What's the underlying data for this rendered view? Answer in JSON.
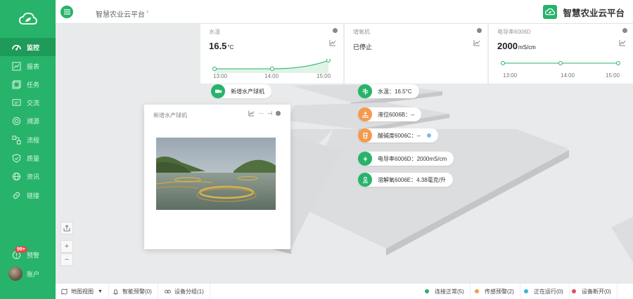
{
  "brand": {
    "title": "智慧农业云平台"
  },
  "breadcrumb": {
    "current": "智慧农业云平台",
    "arrow": "›"
  },
  "sidebar": {
    "items": [
      {
        "label": "监控",
        "icon": "dashboard-icon"
      },
      {
        "label": "报表",
        "icon": "chart-icon"
      },
      {
        "label": "任务",
        "icon": "task-icon"
      },
      {
        "label": "交流",
        "icon": "message-icon"
      },
      {
        "label": "溯源",
        "icon": "trace-icon"
      },
      {
        "label": "流程",
        "icon": "flow-icon"
      },
      {
        "label": "质量",
        "icon": "shield-icon"
      },
      {
        "label": "资讯",
        "icon": "globe-icon"
      },
      {
        "label": "链接",
        "icon": "link-icon"
      }
    ],
    "alarm": {
      "label": "预警",
      "badge": "99+"
    },
    "account": {
      "label": "账户"
    }
  },
  "stats": [
    {
      "label": "水温",
      "value": "16.5",
      "unit": "°C",
      "ticks": [
        "13:00",
        "14:00",
        "15:00"
      ]
    },
    {
      "label": "增氧机",
      "value": "已停止",
      "unit": "",
      "ticks": []
    },
    {
      "label": "电导率6006D",
      "value": "2000",
      "unit": "mS/cm",
      "ticks": [
        "13:00",
        "14:00",
        "15:00"
      ]
    }
  ],
  "callouts": [
    {
      "label": "新增水产球机",
      "icon": "camera-icon"
    },
    {
      "label": "水温：16.5°C",
      "icon": "thermometer-icon"
    },
    {
      "label": "液位6006B：--",
      "icon": "water-level-icon"
    },
    {
      "label": "酸碱度6006C：--",
      "icon": "ph-icon"
    },
    {
      "label": "电导率6006D：2000mS/cm",
      "icon": "lightning-icon"
    },
    {
      "label": "溶解氧6006E：4.38毫克/升",
      "icon": "oxygen-icon"
    }
  ],
  "popup": {
    "title": "新增水产球机",
    "more": "···",
    "pin": "⊣"
  },
  "map_controls": {
    "zoom_in": "+",
    "zoom_out": "−"
  },
  "footer": {
    "map_view": "地图视图",
    "smart_alarm": "智能预警(0)",
    "device_group": "设备分组(1)",
    "status": [
      {
        "label": "连接正常(5)",
        "color": "#27b36a"
      },
      {
        "label": "传感预警(2)",
        "color": "#f49a4e"
      },
      {
        "label": "正在运行(0)",
        "color": "#3ab5e6"
      },
      {
        "label": "设备断开(0)",
        "color": "#e84a5f"
      }
    ]
  },
  "colors": {
    "primary": "#27b36a",
    "accent_orange": "#f49a4e"
  }
}
